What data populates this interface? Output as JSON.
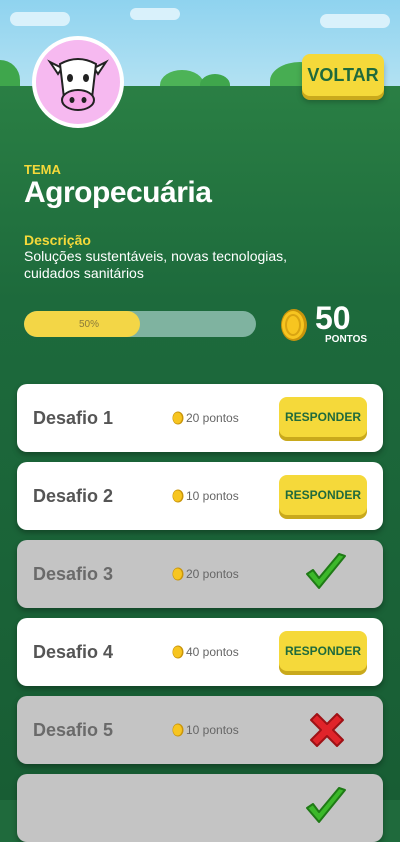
{
  "header": {
    "back_label": "VOLTAR",
    "avatar_icon": "cow-icon"
  },
  "theme": {
    "label": "TEMA",
    "title": "Agropecuária",
    "description_label": "Descrição",
    "description": "Soluções sustentáveis, novas tecnologias, cuidados sanitários"
  },
  "progress": {
    "percent": 50,
    "text": "50%"
  },
  "score": {
    "value": "50",
    "unit": "PONTOS"
  },
  "challenges": [
    {
      "name": "Desafio 1",
      "points": "20 pontos",
      "status": "open",
      "action": "RESPONDER"
    },
    {
      "name": "Desafio 2",
      "points": "10 pontos",
      "status": "open",
      "action": "RESPONDER"
    },
    {
      "name": "Desafio 3",
      "points": "20 pontos",
      "status": "correct",
      "icon": "check-icon"
    },
    {
      "name": "Desafio 4",
      "points": "40 pontos",
      "status": "open",
      "action": "RESPONDER"
    },
    {
      "name": "Desafio 5",
      "points": "10 pontos",
      "status": "wrong",
      "icon": "cross-icon"
    },
    {
      "name": "",
      "points": "",
      "status": "correct",
      "icon": "check-icon"
    }
  ],
  "colors": {
    "accent_yellow": "#f5d93a",
    "field_green": "#1f6a3c",
    "correct_green": "#3cb82a",
    "wrong_red": "#e0242a"
  }
}
